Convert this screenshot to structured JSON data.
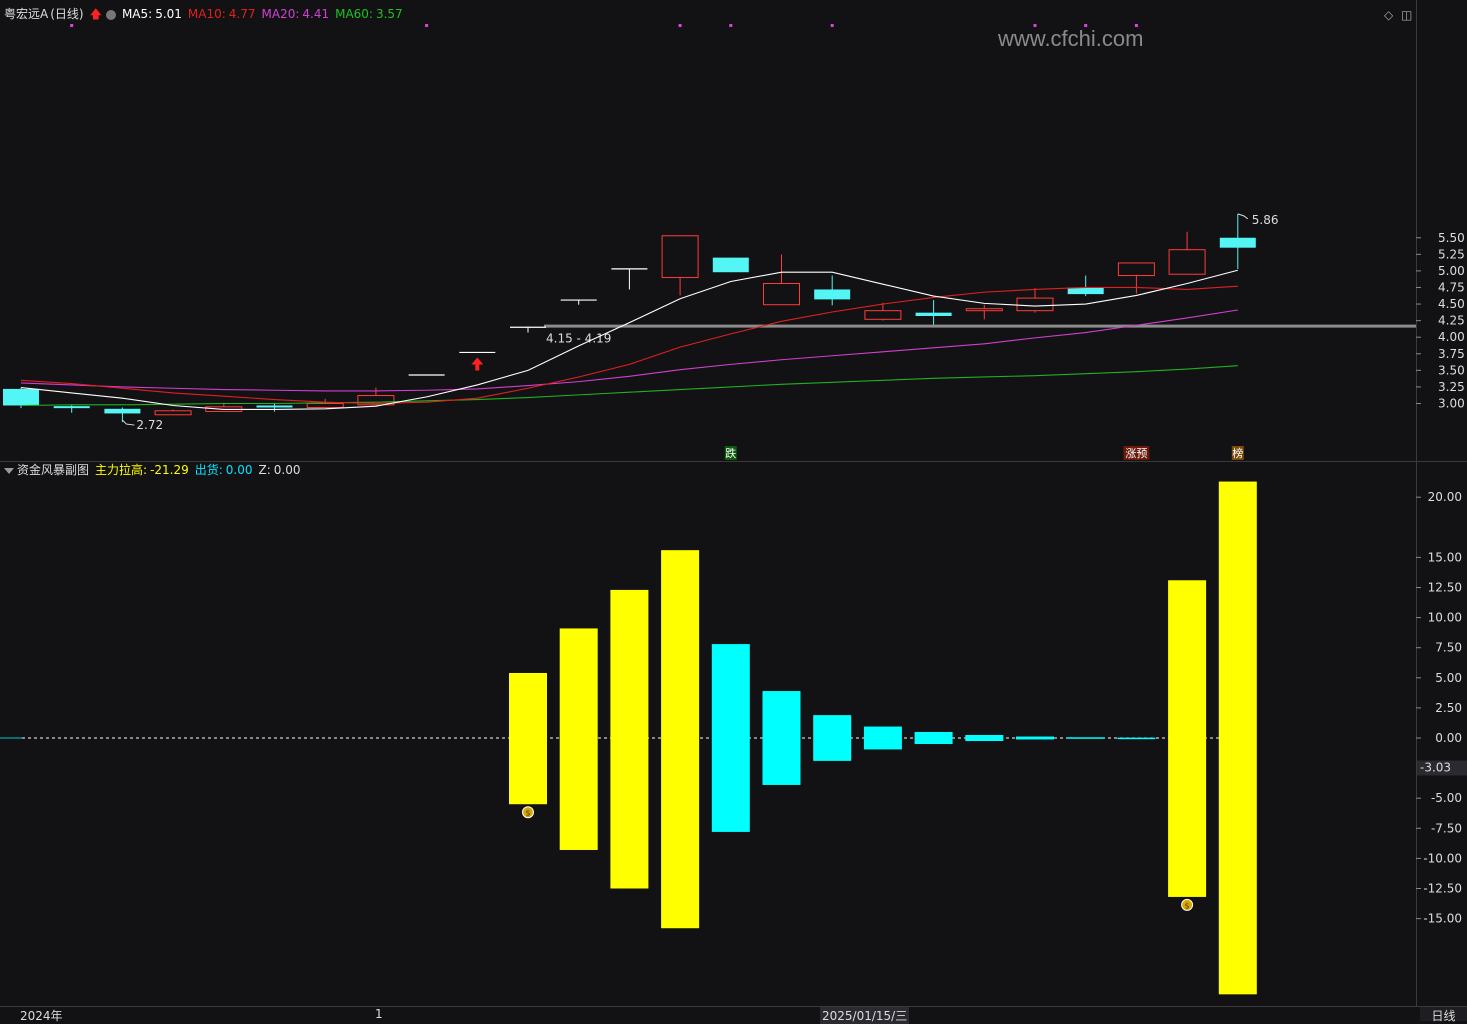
{
  "header_main": {
    "stock_name": "粤宏远A",
    "period": "(日线)",
    "ma5_label": "MA5:",
    "ma5_value": "5.01",
    "ma10_label": "MA10:",
    "ma10_value": "4.77",
    "ma20_label": "MA20:",
    "ma20_value": "4.41",
    "ma60_label": "MA60:",
    "ma60_value": "3.57"
  },
  "header_sub": {
    "indicator_name": "资金风暴副图",
    "zhuli_label": "主力拉高:",
    "zhuli_value": "-21.29",
    "chuhuo_label": "出货:",
    "chuhuo_value": "0.00",
    "z_label": "Z:",
    "z_value": "0.00"
  },
  "watermark": "www.cfchi.com",
  "annotations": {
    "high_label": "5.86",
    "low_label": "2.72",
    "band_label": "4.15 - 4.19",
    "mark_die": "跌",
    "mark_zhangyu": "涨预",
    "mark_bang": "榜"
  },
  "x_axis": {
    "left_label": "2024年",
    "month_label": "1",
    "date_label": "2025/01/15/三"
  },
  "period_button": "日线",
  "sub_axis_marker": "-3.03",
  "colors": {
    "background": "#121214",
    "up": "#ff3b3b",
    "down": "#54f5f5",
    "ma5": "#ffffff",
    "ma10": "#e02020",
    "ma20": "#d040d0",
    "ma60": "#20b020",
    "bar_yellow": "#ffff00",
    "bar_cyan": "#00ffff",
    "grid": "#2a2a2e"
  },
  "chart_data": [
    {
      "type": "candlestick",
      "y_ticks": [
        "5.50",
        "5.25",
        "5.00",
        "4.75",
        "4.50",
        "4.25",
        "4.00",
        "3.75",
        "3.50",
        "3.25",
        "3.00"
      ],
      "ylim": [
        2.55,
        5.95
      ],
      "candles": [
        {
          "o": 3.22,
          "c": 2.97,
          "h": 3.24,
          "l": 2.93
        },
        {
          "o": 2.96,
          "c": 2.93,
          "h": 2.98,
          "l": 2.86
        },
        {
          "o": 2.92,
          "c": 2.85,
          "h": 2.94,
          "l": 2.72
        },
        {
          "o": 2.83,
          "c": 2.89,
          "h": 2.91,
          "l": 2.83
        },
        {
          "o": 2.88,
          "c": 2.95,
          "h": 3.01,
          "l": 2.88
        },
        {
          "o": 2.97,
          "c": 2.94,
          "h": 3.01,
          "l": 2.88
        },
        {
          "o": 2.94,
          "c": 3.0,
          "h": 3.07,
          "l": 2.94
        },
        {
          "o": 2.98,
          "c": 3.12,
          "h": 3.24,
          "l": 2.97
        },
        {
          "o": 3.43,
          "c": 3.43,
          "h": 3.43,
          "l": 3.43
        },
        {
          "o": 3.77,
          "c": 3.77,
          "h": 3.77,
          "l": 3.77
        },
        {
          "o": 4.15,
          "c": 4.15,
          "h": 4.15,
          "l": 4.07
        },
        {
          "o": 4.56,
          "c": 4.56,
          "h": 4.56,
          "l": 4.49
        },
        {
          "o": 5.03,
          "c": 5.03,
          "h": 5.03,
          "l": 4.72
        },
        {
          "o": 4.9,
          "c": 5.53,
          "h": 5.53,
          "l": 4.63
        },
        {
          "o": 5.2,
          "c": 4.98,
          "h": 5.2,
          "l": 4.98
        },
        {
          "o": 4.49,
          "c": 4.81,
          "h": 5.25,
          "l": 4.49
        },
        {
          "o": 4.72,
          "c": 4.57,
          "h": 4.93,
          "l": 4.48
        },
        {
          "o": 4.27,
          "c": 4.4,
          "h": 4.52,
          "l": 4.25
        },
        {
          "o": 4.37,
          "c": 4.32,
          "h": 4.56,
          "l": 4.19
        },
        {
          "o": 4.4,
          "c": 4.43,
          "h": 4.49,
          "l": 4.27
        },
        {
          "o": 4.4,
          "c": 4.59,
          "h": 4.74,
          "l": 4.37
        },
        {
          "o": 4.75,
          "c": 4.65,
          "h": 4.93,
          "l": 4.62
        },
        {
          "o": 4.93,
          "c": 5.12,
          "h": 5.12,
          "l": 4.66
        },
        {
          "o": 4.95,
          "c": 5.32,
          "h": 5.59,
          "l": 4.95
        },
        {
          "o": 5.5,
          "c": 5.35,
          "h": 5.86,
          "l": 5.03
        }
      ],
      "ma5": [
        3.24,
        3.16,
        3.08,
        2.97,
        2.91,
        2.91,
        2.92,
        2.96,
        3.1,
        3.28,
        3.5,
        3.87,
        4.22,
        4.58,
        4.84,
        4.98,
        4.98,
        4.8,
        4.62,
        4.51,
        4.47,
        4.5,
        4.63,
        4.81,
        5.01
      ],
      "ma10": [
        3.35,
        3.3,
        3.23,
        3.16,
        3.11,
        3.06,
        3.02,
        3.0,
        3.02,
        3.08,
        3.23,
        3.4,
        3.59,
        3.85,
        4.05,
        4.24,
        4.38,
        4.5,
        4.6,
        4.68,
        4.72,
        4.75,
        4.75,
        4.72,
        4.77
      ],
      "ma20": [
        3.31,
        3.28,
        3.25,
        3.23,
        3.21,
        3.2,
        3.19,
        3.19,
        3.2,
        3.22,
        3.27,
        3.33,
        3.41,
        3.51,
        3.59,
        3.66,
        3.72,
        3.78,
        3.84,
        3.9,
        3.99,
        4.07,
        4.18,
        4.29,
        4.41
      ],
      "ma60": [
        2.97,
        2.98,
        2.98,
        2.99,
        3.0,
        3.0,
        3.01,
        3.02,
        3.04,
        3.06,
        3.09,
        3.13,
        3.17,
        3.21,
        3.25,
        3.29,
        3.32,
        3.35,
        3.38,
        3.4,
        3.42,
        3.45,
        3.48,
        3.52,
        3.57
      ],
      "band": [
        4.15,
        4.19
      ]
    },
    {
      "type": "bar",
      "y_ticks": [
        "20.00",
        "15.00",
        "12.50",
        "10.00",
        "7.50",
        "5.00",
        "2.50",
        "0.00",
        "-5.00",
        "-7.50",
        "-10.00",
        "-12.50",
        "-15.00"
      ],
      "ylim": [
        -21.5,
        21.5
      ],
      "bars": [
        {
          "i": 10,
          "value": 5.4,
          "bottom": -5.5,
          "color": "yellow"
        },
        {
          "i": 11,
          "value": 9.1,
          "bottom": -9.3,
          "color": "yellow"
        },
        {
          "i": 12,
          "value": 12.3,
          "bottom": -12.5,
          "color": "yellow"
        },
        {
          "i": 13,
          "value": 15.6,
          "bottom": -15.8,
          "color": "yellow"
        },
        {
          "i": 14,
          "value": 7.8,
          "bottom": -7.8,
          "color": "cyan"
        },
        {
          "i": 15,
          "value": 3.9,
          "bottom": -3.9,
          "color": "cyan"
        },
        {
          "i": 16,
          "value": 1.9,
          "bottom": -1.9,
          "color": "cyan"
        },
        {
          "i": 17,
          "value": 0.95,
          "bottom": -0.95,
          "color": "cyan"
        },
        {
          "i": 18,
          "value": 0.5,
          "bottom": -0.5,
          "color": "cyan"
        },
        {
          "i": 19,
          "value": 0.25,
          "bottom": -0.25,
          "color": "cyan"
        },
        {
          "i": 20,
          "value": 0.12,
          "bottom": -0.12,
          "color": "cyan"
        },
        {
          "i": 21,
          "value": 0.06,
          "bottom": -0.06,
          "color": "cyan"
        },
        {
          "i": 22,
          "value": 0.03,
          "bottom": -0.03,
          "color": "cyan"
        },
        {
          "i": 23,
          "value": 13.1,
          "bottom": -13.2,
          "color": "yellow"
        },
        {
          "i": 24,
          "value": 21.3,
          "bottom": -21.29,
          "color": "yellow"
        }
      ]
    }
  ]
}
